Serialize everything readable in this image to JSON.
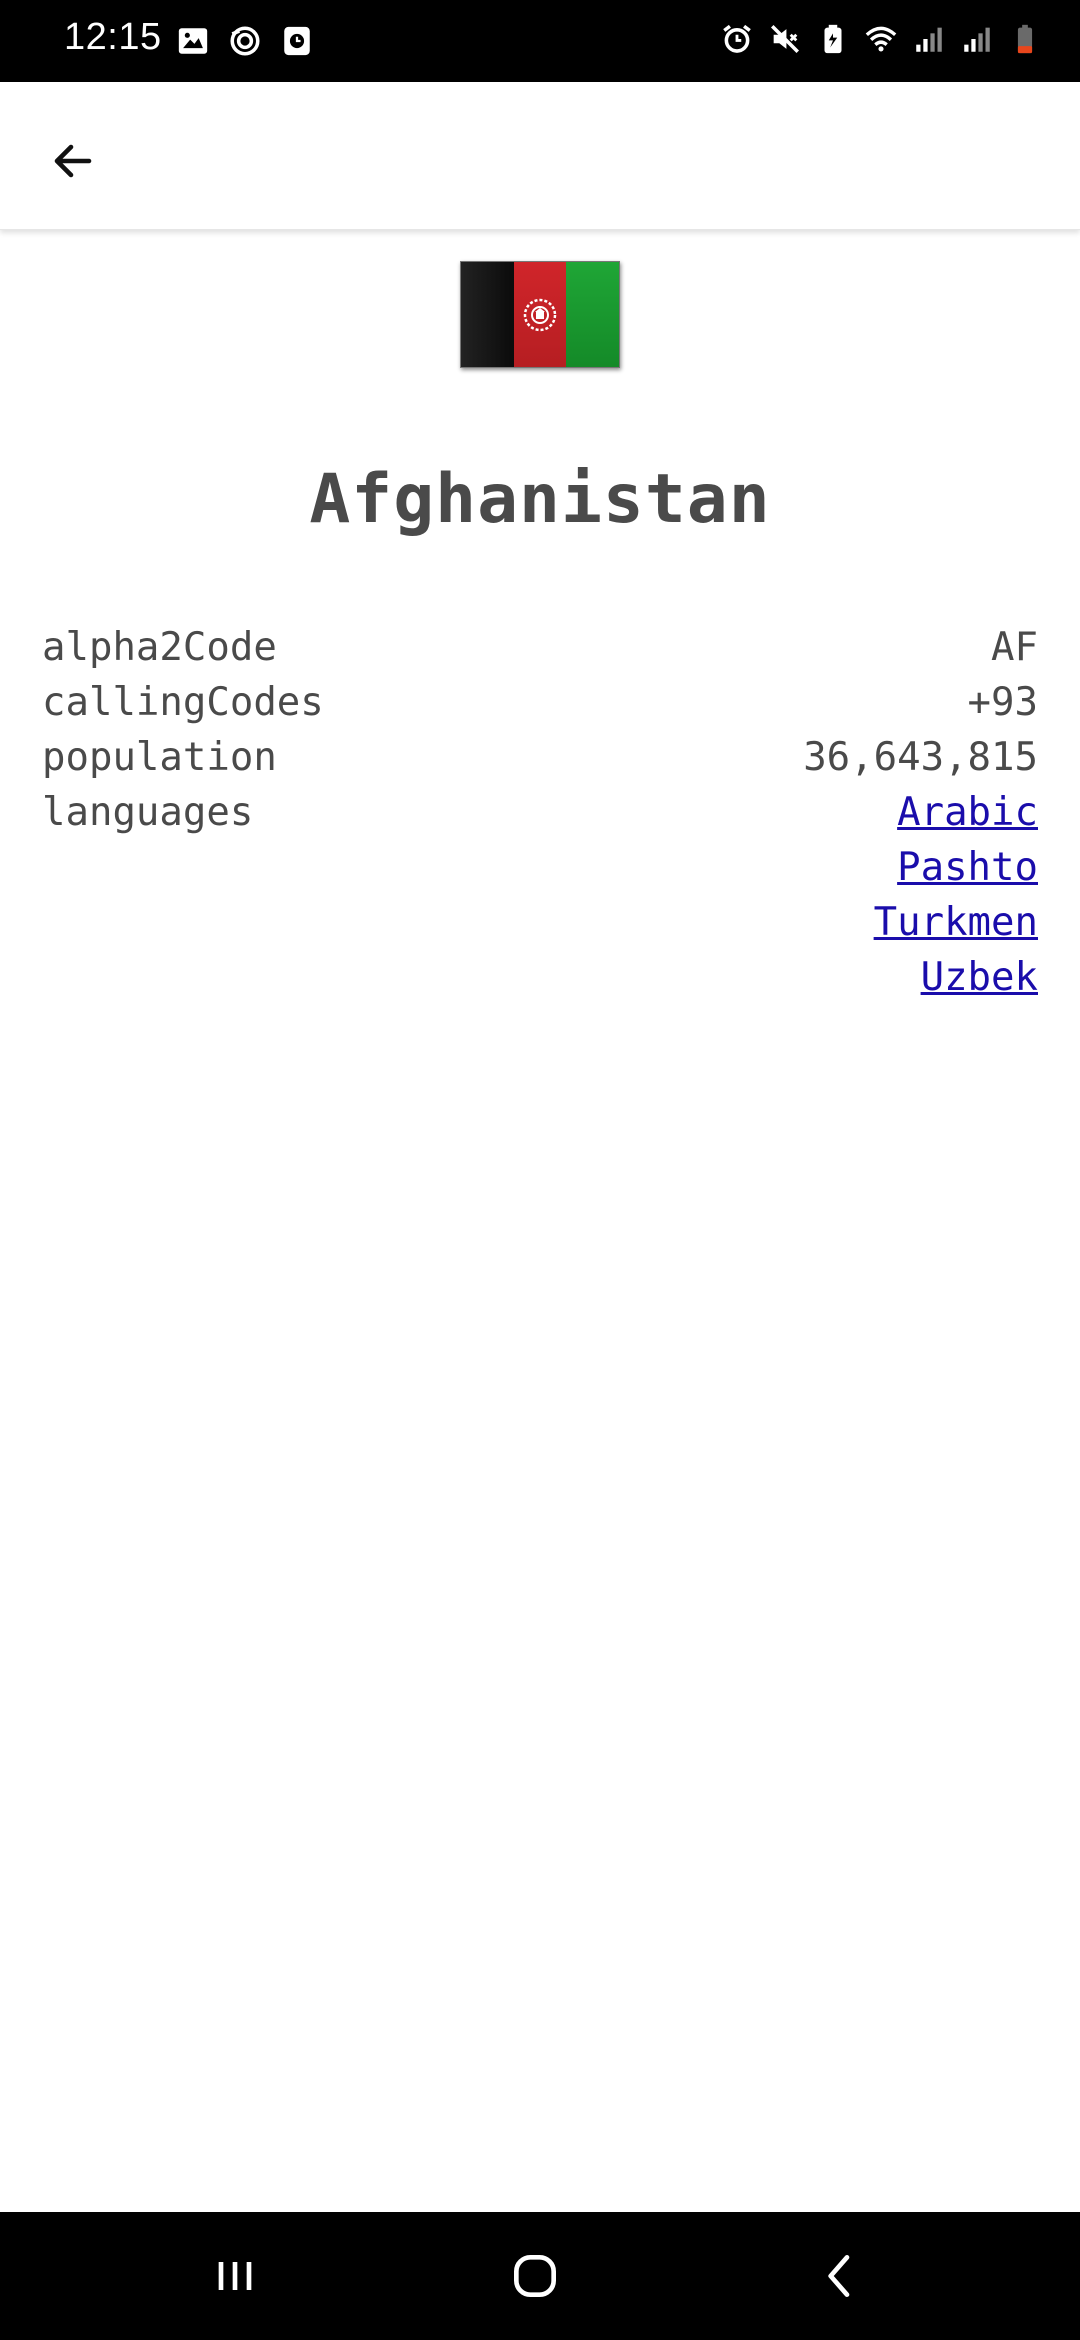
{
  "status_bar": {
    "time": "12:15",
    "left_icons": [
      "image-icon",
      "sync-icon",
      "clock-app-icon"
    ],
    "right_icons": [
      "alarm-icon",
      "mute-icon",
      "battery-saver-icon",
      "wifi-icon",
      "signal-icon",
      "signal-icon",
      "battery-icon"
    ]
  },
  "app_bar": {
    "back_icon": "arrow-left-icon"
  },
  "country": {
    "name": "Afghanistan",
    "flag": {
      "colors": [
        "#000000",
        "#d32011",
        "#009a00"
      ]
    }
  },
  "details": {
    "alpha2Code": {
      "label": "alpha2Code",
      "value": "AF"
    },
    "callingCodes": {
      "label": "callingCodes",
      "value": "+93"
    },
    "population": {
      "label": "population",
      "value": "36,643,815"
    },
    "languages": {
      "label": "languages",
      "items": [
        "Arabic",
        "Pashto",
        "Turkmen",
        "Uzbek"
      ]
    }
  },
  "nav_bar": {
    "icons": [
      "recent-apps-icon",
      "home-icon",
      "back-icon"
    ]
  }
}
